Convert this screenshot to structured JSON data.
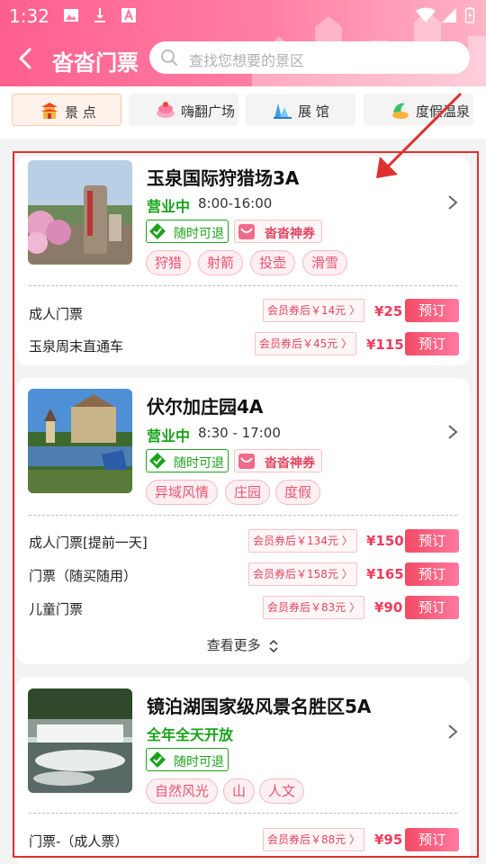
{
  "status_bar": {
    "time": "1:32"
  },
  "header": {
    "title": "沓沓门票",
    "search_placeholder": "查找您想要的景区"
  },
  "tabs": [
    {
      "label": "景 点",
      "active": true,
      "icon": "pagoda-icon"
    },
    {
      "label": "嗨翻广场",
      "active": false,
      "icon": "cake-icon"
    },
    {
      "label": "展 馆",
      "active": false,
      "icon": "building-icon"
    },
    {
      "label": "度假温泉",
      "active": false,
      "icon": "hotspring-icon"
    }
  ],
  "colors": {
    "accent": "#ff6a96",
    "price": "#ef3b5b",
    "green": "#1aa31a"
  },
  "attractions": [
    {
      "name": "玉泉国际狩猎场3A",
      "status": "营业中",
      "hours": "8:00-16:00",
      "refund_badge": "随时可退",
      "coupon_badge": "沓沓神券",
      "tags": [
        "狩猎",
        "射箭",
        "投壶",
        "滑雪"
      ],
      "tickets": [
        {
          "name": "成人门票",
          "coupon": "会员券后￥14元 〉",
          "price": "¥25",
          "book": "预订"
        },
        {
          "name": "玉泉周末直通车",
          "coupon": "会员券后￥45元 〉",
          "price": "¥115",
          "book": "预订"
        }
      ]
    },
    {
      "name": "伏尔加庄园4A",
      "status": "营业中",
      "hours": "8:30 - 17:00",
      "refund_badge": "随时可退",
      "coupon_badge": "沓沓神券",
      "tags": [
        "异域风情",
        "庄园",
        "度假"
      ],
      "tickets": [
        {
          "name": "成人门票[提前一天]",
          "coupon": "会员券后￥134元 〉",
          "price": "¥150",
          "book": "预订"
        },
        {
          "name": "门票（随买随用）",
          "coupon": "会员券后￥158元 〉",
          "price": "¥165",
          "book": "预订"
        },
        {
          "name": "儿童门票",
          "coupon": "会员券后￥83元 〉",
          "price": "¥90",
          "book": "预订"
        }
      ],
      "more_label": "查看更多"
    },
    {
      "name": "镜泊湖国家级风景名胜区5A",
      "status": "全年全天开放",
      "refund_badge": "随时可退",
      "tags": [
        "自然风光",
        "山",
        "人文"
      ],
      "tickets": [
        {
          "name": "门票-（成人票）",
          "coupon": "会员券后￥88元 〉",
          "price": "¥95",
          "book": "预订"
        }
      ]
    }
  ]
}
